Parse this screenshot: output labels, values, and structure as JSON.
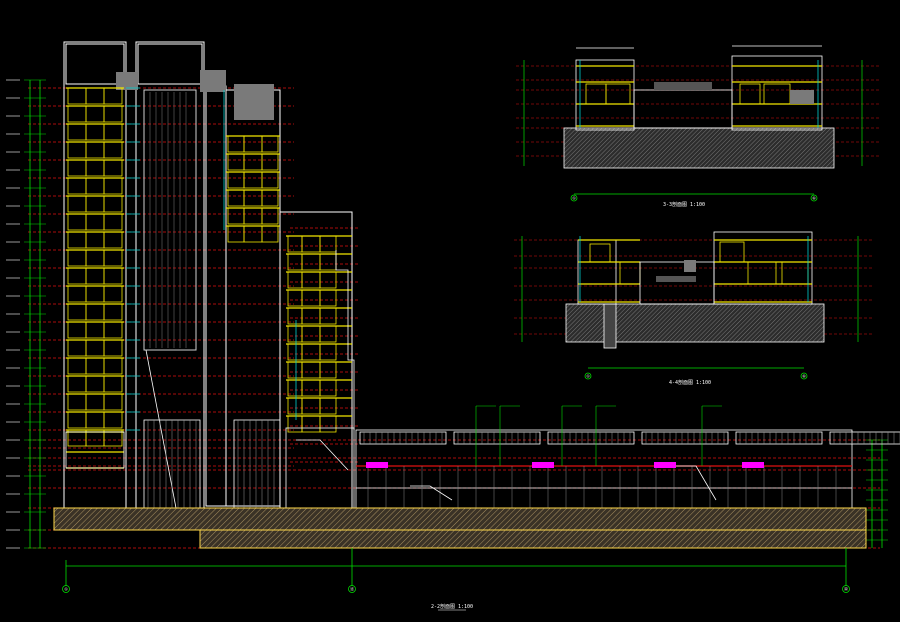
{
  "drawing": {
    "main_title": "2-2剖面图 1:100",
    "section_a_title": "3-3剖面图 1:100",
    "section_b_title": "4-4剖面图 1:100",
    "grid_main": [
      "①",
      "⑬",
      "㉒"
    ],
    "grid_a": [
      "①",
      "⑥"
    ],
    "grid_b": [
      "①",
      "⑥"
    ],
    "colors": {
      "background": "#000000",
      "floor_line": "#e01010",
      "slab": "#f2e600",
      "wall": "#ffffff",
      "glass": "#00d0d0",
      "dimension": "#00e000",
      "tag": "#ff00ff",
      "fill": "#7a7a7a",
      "ground": "#a89060"
    }
  }
}
